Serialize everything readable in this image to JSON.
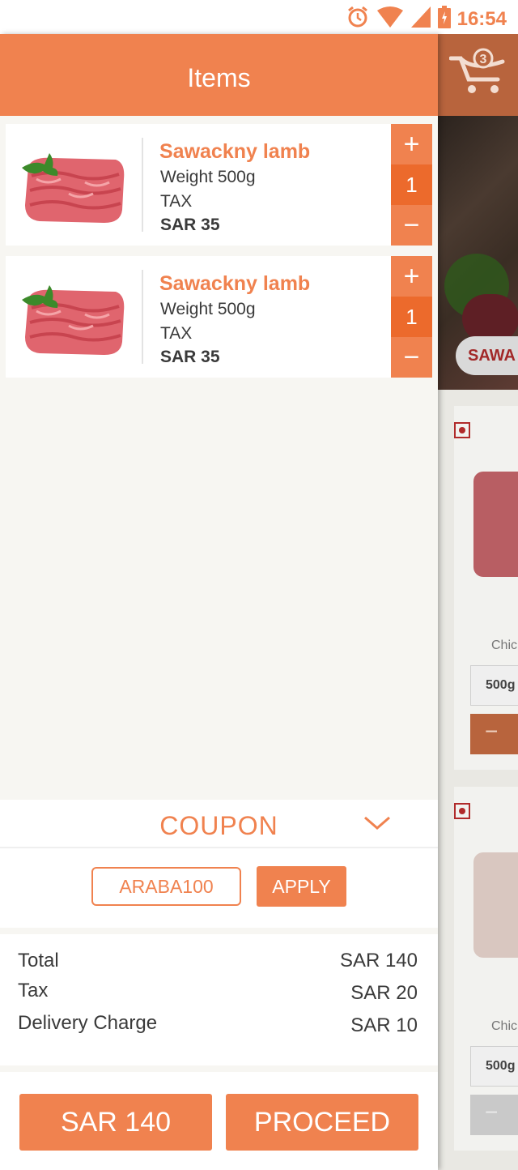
{
  "status_bar": {
    "time": "16:54"
  },
  "drawer": {
    "title": "Items"
  },
  "items": [
    {
      "name": "Sawackny lamb",
      "weight": "Weight 500g",
      "tax": "TAX",
      "price": "SAR 35",
      "qty": "1"
    },
    {
      "name": "Sawackny lamb",
      "weight": "Weight 500g",
      "tax": "TAX",
      "price": "SAR 35",
      "qty": "1"
    }
  ],
  "stepper": {
    "plus": "+",
    "minus": "−"
  },
  "coupon": {
    "title": "COUPON",
    "code": "ARABA100",
    "apply_label": "APPLY"
  },
  "totals": {
    "total_label": "Total",
    "total_value": "SAR 140",
    "tax_label": "Tax",
    "tax_value": "SAR 20",
    "delivery_label": "Delivery Charge",
    "delivery_value": "SAR 10"
  },
  "footer": {
    "total_button": "SAR 140",
    "proceed_button": "PROCEED"
  },
  "background_app": {
    "cart_count": "3",
    "banner_label": "SAWA",
    "product_labels": [
      "Chic",
      "Chic"
    ],
    "weights": [
      "500g",
      "500g"
    ],
    "minus": "−"
  },
  "colors": {
    "accent": "#f0824f",
    "accent_dark": "#ec6a2c",
    "text": "#3a3a3a"
  },
  "icons": [
    "alarm-icon",
    "wifi-icon",
    "signal-icon",
    "battery-icon",
    "cart-icon",
    "chevron-down-icon"
  ]
}
